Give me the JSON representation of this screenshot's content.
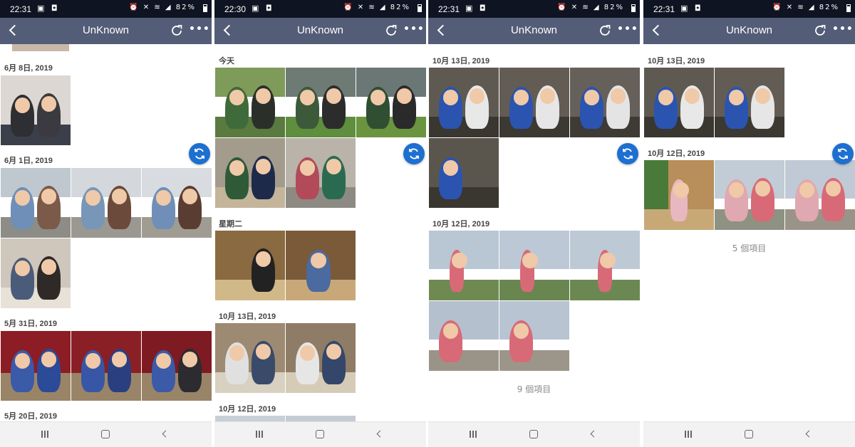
{
  "screens": [
    {
      "status": {
        "time": "22:31",
        "battery": "82%"
      },
      "title": "UnKnown",
      "dates": [
        "6月 8日, 2019",
        "6月 1日, 2019",
        "5月 31日, 2019",
        "5月 20日, 2019"
      ],
      "count_label": ""
    },
    {
      "status": {
        "time": "22:30",
        "battery": "82%"
      },
      "title": "UnKnown",
      "dates": [
        "今天",
        "星期二",
        "10月 13日, 2019",
        "10月 12日, 2019"
      ],
      "count_label": ""
    },
    {
      "status": {
        "time": "22:31",
        "battery": "82%"
      },
      "title": "UnKnown",
      "dates": [
        "10月 13日, 2019",
        "10月 12日, 2019"
      ],
      "count_label": "9 個項目"
    },
    {
      "status": {
        "time": "22:31",
        "battery": "82%"
      },
      "title": "UnKnown",
      "dates": [
        "10月 13日, 2019",
        "10月 12日, 2019"
      ],
      "count_label": "5 個項目"
    }
  ],
  "icons": {
    "back": "back-arrow-icon",
    "refresh": "refresh-icon",
    "more": "more-options-icon",
    "fab": "sync-icon",
    "nav": [
      "recents-icon",
      "home-icon",
      "back-icon"
    ]
  },
  "colors": {
    "statusbar": "#0e1422",
    "appbar": "#545d77",
    "fab": "#1d6fd0",
    "navbar": "#f2f2f2"
  }
}
